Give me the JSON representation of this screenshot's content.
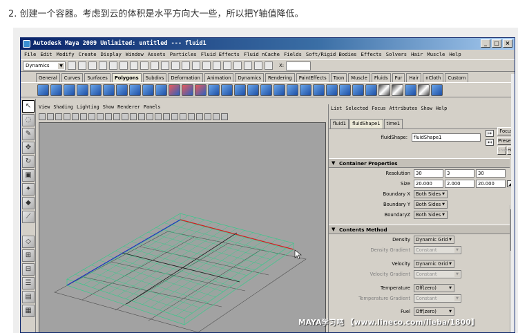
{
  "caption": "2. 创建一个容器。考虑到云的体积是水平方向大一些，所以把Y轴值降低。",
  "window": {
    "title": "Autodesk Maya 2009 Unlimited: untitled   ---   fluid1",
    "buttons": [
      "_",
      "□",
      "×"
    ]
  },
  "menubar": [
    "File",
    "Edit",
    "Modify",
    "Create",
    "Display",
    "Window",
    "Assets",
    "Particles",
    "Fluid Effects",
    "Fluid nCache",
    "Fields",
    "Soft/Rigid Bodies",
    "Effects",
    "Solvers",
    "Hair",
    "Muscle",
    "Help"
  ],
  "statusline": {
    "mode": "Dynamics",
    "input_label": "X:"
  },
  "shelf_tabs": [
    "General",
    "Curves",
    "Surfaces",
    "Polygons",
    "Subdivs",
    "Deformation",
    "Animation",
    "Dynamics",
    "Rendering",
    "PaintEffects",
    "Toon",
    "Muscle",
    "Fluids",
    "Fur",
    "Hair",
    "nCloth",
    "Custom"
  ],
  "shelf_active": "Polygons",
  "viewport": {
    "menu": [
      "View",
      "Shading",
      "Lighting",
      "Show",
      "Renderer",
      "Panels"
    ]
  },
  "attribute_editor": {
    "menu": [
      "List",
      "Selected",
      "Focus",
      "Attributes",
      "Show",
      "Help"
    ],
    "tabs": [
      "fluid1",
      "fluidShape1",
      "time1"
    ],
    "active_tab": "fluidShape1",
    "node_label": "fluidShape:",
    "node_value": "fluidShape1",
    "buttons": {
      "focus": "Focus",
      "presets": "Presets*",
      "show": "Show",
      "hide": "Hide"
    },
    "container": {
      "title": "Container Properties",
      "resolution_label": "Resolution",
      "resolution": [
        "30",
        "3",
        "30"
      ],
      "size_label": "Size",
      "size": [
        "20.000",
        "2.000",
        "20.000"
      ],
      "boundary_x_label": "Boundary X",
      "boundary_x": "Both Sides",
      "boundary_y_label": "Boundary Y",
      "boundary_y": "Both Sides",
      "boundary_z_label": "BoundaryZ",
      "boundary_z": "Both Sides"
    },
    "contents": {
      "title": "Contents Method",
      "density_label": "Density",
      "density": "Dynamic Grid",
      "density_gradient_label": "Density Gradient",
      "density_gradient": "Constant",
      "velocity_label": "Velocity",
      "velocity": "Dynamic Grid",
      "velocity_gradient_label": "Velocity Gradient",
      "velocity_gradient": "Constant",
      "temperature_label": "Temperature",
      "temperature": "Off(zero)",
      "temperature_gradient_label": "Temperature Gradient",
      "temperature_gradient": "Constant",
      "fuel_label": "Fuel",
      "fuel": "Off(zero)"
    }
  },
  "watermark": "MAYA学习吧 【www.lineco.com/lieba/1800】",
  "colors": {
    "grid": "#36c98a",
    "x_axis": "#d02020",
    "z_axis": "#2030c0",
    "viewport_bg": "#a2a2a2"
  }
}
